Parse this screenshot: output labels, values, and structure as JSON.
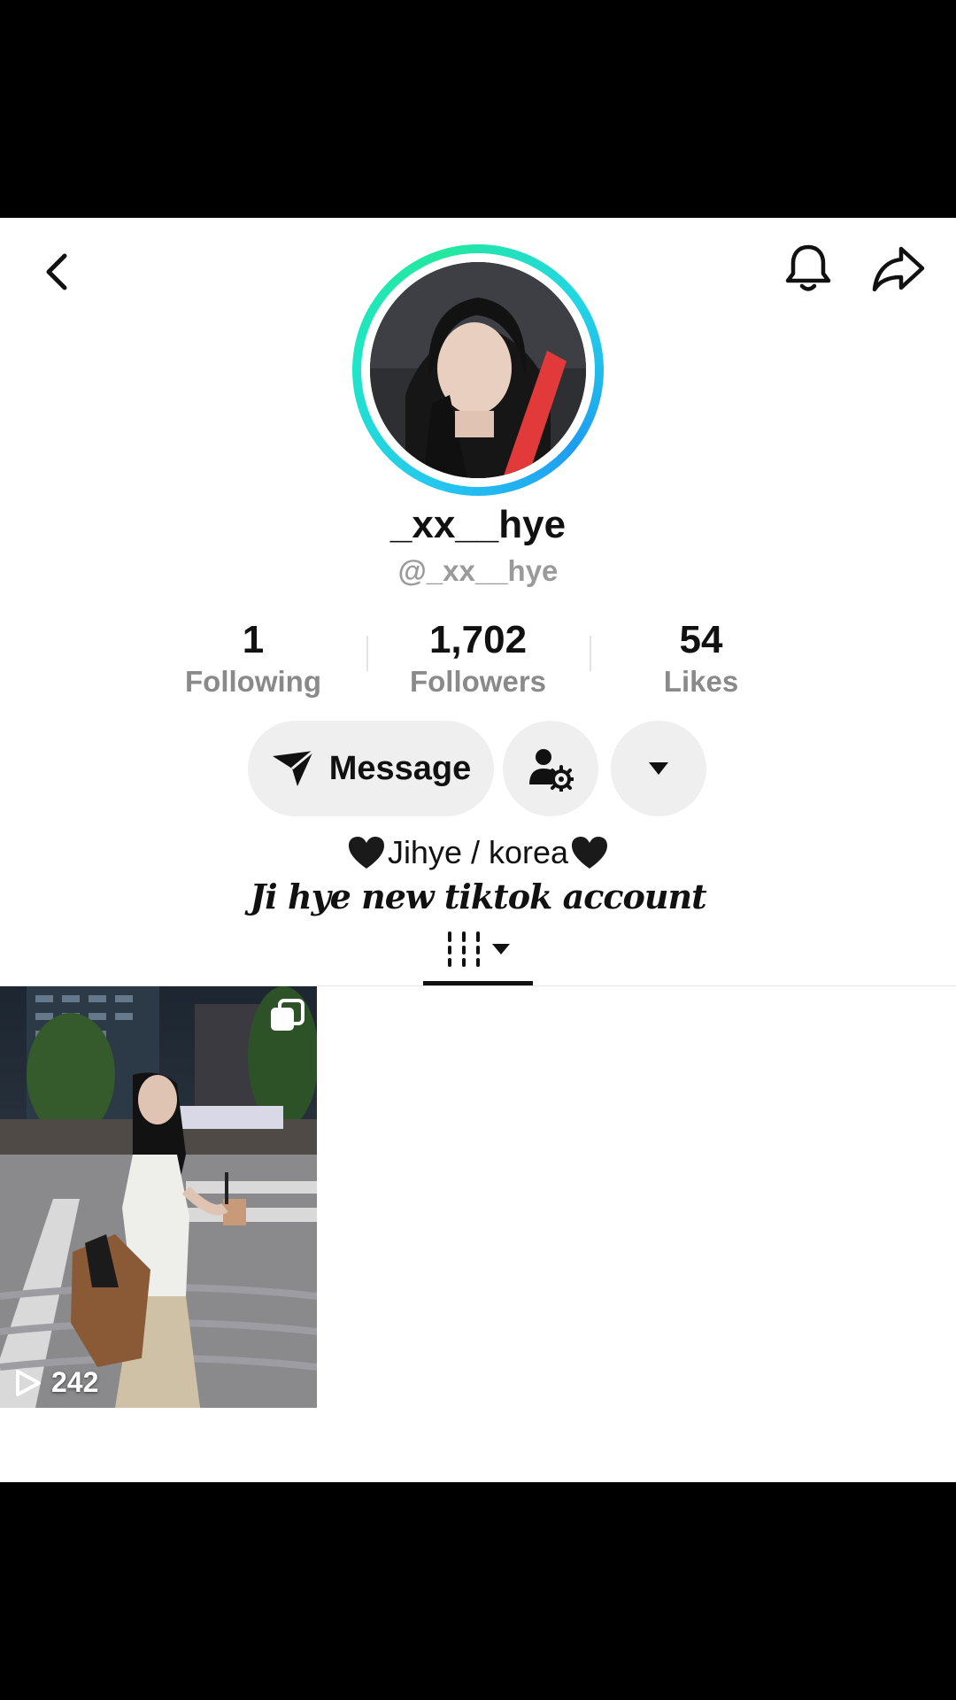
{
  "profile": {
    "display_name": "_xx__hye",
    "handle": "@_xx__hye"
  },
  "stats": [
    {
      "value": "1",
      "label": "Following"
    },
    {
      "value": "1,702",
      "label": "Followers"
    },
    {
      "value": "54",
      "label": "Likes"
    }
  ],
  "actions": {
    "message_label": "Message"
  },
  "bio": {
    "line1": "Jihye / korea",
    "line2": "Ji hye new tiktok account"
  },
  "videos": [
    {
      "views": "242"
    }
  ],
  "colors": {
    "ring_start": "#25c7f0",
    "ring_end": "#23e89e",
    "button_bg": "#efefef",
    "muted_text": "#8a8a8a"
  },
  "icons": [
    "back-arrow-icon",
    "bell-icon",
    "share-icon",
    "send-icon",
    "person-gear-icon",
    "triangle-down-icon",
    "grid-bars-icon",
    "play-icon",
    "multi-photo-icon",
    "black-heart-icon"
  ]
}
